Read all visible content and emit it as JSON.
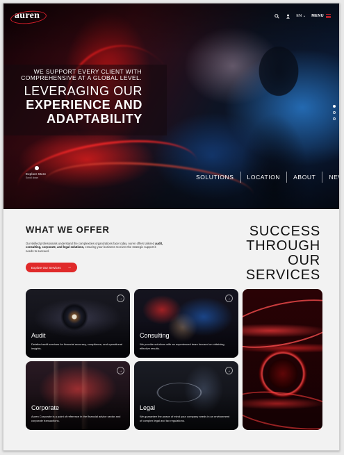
{
  "header": {
    "logo": "auren",
    "lang": "EN",
    "menu_label": "MENU"
  },
  "hero": {
    "sub_line1": "WE SUPPORT EVERY CLIENT WITH",
    "sub_line2": "COMPREHENSIVE AT A GLOBAL LEVEL.",
    "main_line1": "LEVERAGING OUR",
    "main_line2": "EXPERIENCE AND",
    "main_line3": "ADAPTABILITY",
    "explore_label": "Explore More",
    "explore_sub": "Scroll down",
    "nav": [
      "SOLUTIONS",
      "LOCATION",
      "ABOUT",
      "NEWS"
    ],
    "slide_count": 3,
    "active_slide": 1
  },
  "offer": {
    "title": "WHAT WE OFFER",
    "text_intro": "Our skilled professionals understand the complexities organizations face today. Auren offers tailored ",
    "text_bold": "audit, consulting, corporate, and legal solutions,",
    "text_outro": " ensuring your business receives the strategic support it needs to succeed.",
    "cta_label": "Explore Our Services",
    "success_line1": "SUCCESS",
    "success_line2": "THROUGH",
    "success_line3": "OUR SERVICES"
  },
  "services": [
    {
      "title": "Audit",
      "desc": "Detailed audit services for financial accuracy, compliance, and operational insights."
    },
    {
      "title": "Consulting",
      "desc": "We provide solutions with an experienced team focused on obtaining effective results."
    },
    {
      "title": "Corporate",
      "desc": "Auren Corporate is a point of reference in the financial advice sector and corporate transactions."
    },
    {
      "title": "Legal",
      "desc": "We guarantee the peace of mind your company needs in an environment of complex legal and tax regulations."
    }
  ],
  "colors": {
    "accent": "#e02a2a",
    "text_dark": "#1b1b1b",
    "page_bg": "#f2f2f2"
  }
}
